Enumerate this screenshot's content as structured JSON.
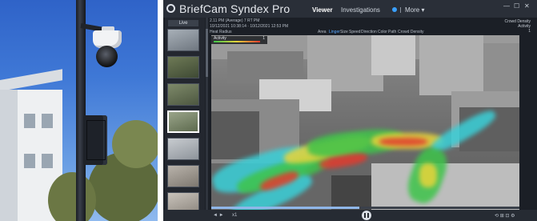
{
  "app": {
    "title": "BriefCam Syndex Pro",
    "nav": {
      "viewer": "Viewer",
      "investigations": "Investigations",
      "more": "More"
    },
    "window_controls": [
      "—",
      "☐",
      "✕"
    ]
  },
  "hud": {
    "line1": "2.11 PM (Average) 7 RT PM",
    "line2": "10/12/2021 10:38:14 · 10/12/2021 12:53 PM",
    "filter_label": "Heat Radius",
    "filters": [
      "Area",
      "Linger",
      "Size",
      "Speed",
      "Direction",
      "Color",
      "Path",
      "Crowd Density"
    ],
    "right_info": [
      "Crowd Density",
      "Activity",
      "1"
    ]
  },
  "sidebar": {
    "header": "Live",
    "thumbnails": [
      "camera-1",
      "camera-2",
      "camera-3",
      "camera-4",
      "camera-5",
      "camera-6",
      "camera-7"
    ]
  },
  "activity": {
    "label": "Activity",
    "value": "1"
  },
  "toolbar": {
    "left": "◄ ►",
    "speed": "x1",
    "right": "⟲ ⊞ ⊡ ⚙"
  },
  "playback": {
    "progress": 0.48
  },
  "colors": {
    "heat_red": "#e23b2e",
    "heat_yellow": "#e8d43a",
    "heat_green": "#3ec44a",
    "heat_cyan": "#3ad0d8",
    "accent": "#3aa0ff"
  }
}
